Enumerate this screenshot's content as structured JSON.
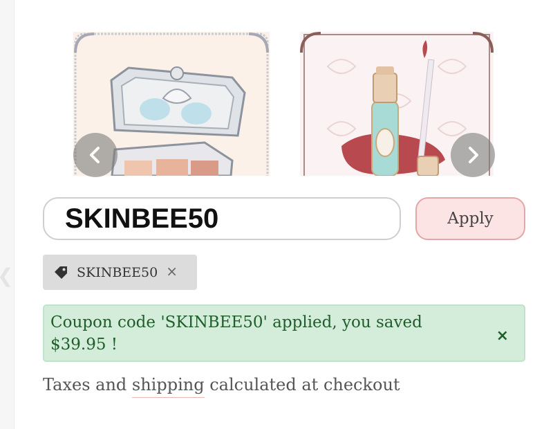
{
  "carousel": {
    "items": [
      {
        "name": "eyeshadow-palette-image"
      },
      {
        "name": "lip-gloss-image"
      }
    ],
    "prev_icon": "chevron-left-icon",
    "next_icon": "chevron-right-icon"
  },
  "coupon": {
    "input_value": "SKINBEE50",
    "apply_label": "Apply",
    "applied_code": "SKINBEE50",
    "tag_icon": "tag-icon",
    "remove_icon": "close-icon",
    "remove_glyph": "×"
  },
  "message": {
    "text": "Coupon code 'SKINBEE50' applied, you saved $39.95 !",
    "close_glyph": "×",
    "background": "#d4edda",
    "text_color": "#1f5d2b"
  },
  "footer": {
    "prefix": "Taxes and ",
    "link": "shipping",
    "suffix": " calculated at checkout"
  },
  "colors": {
    "apply_bg": "#fde4e4",
    "apply_border": "#e3a6a6",
    "tag_bg": "#dcdcdc"
  }
}
